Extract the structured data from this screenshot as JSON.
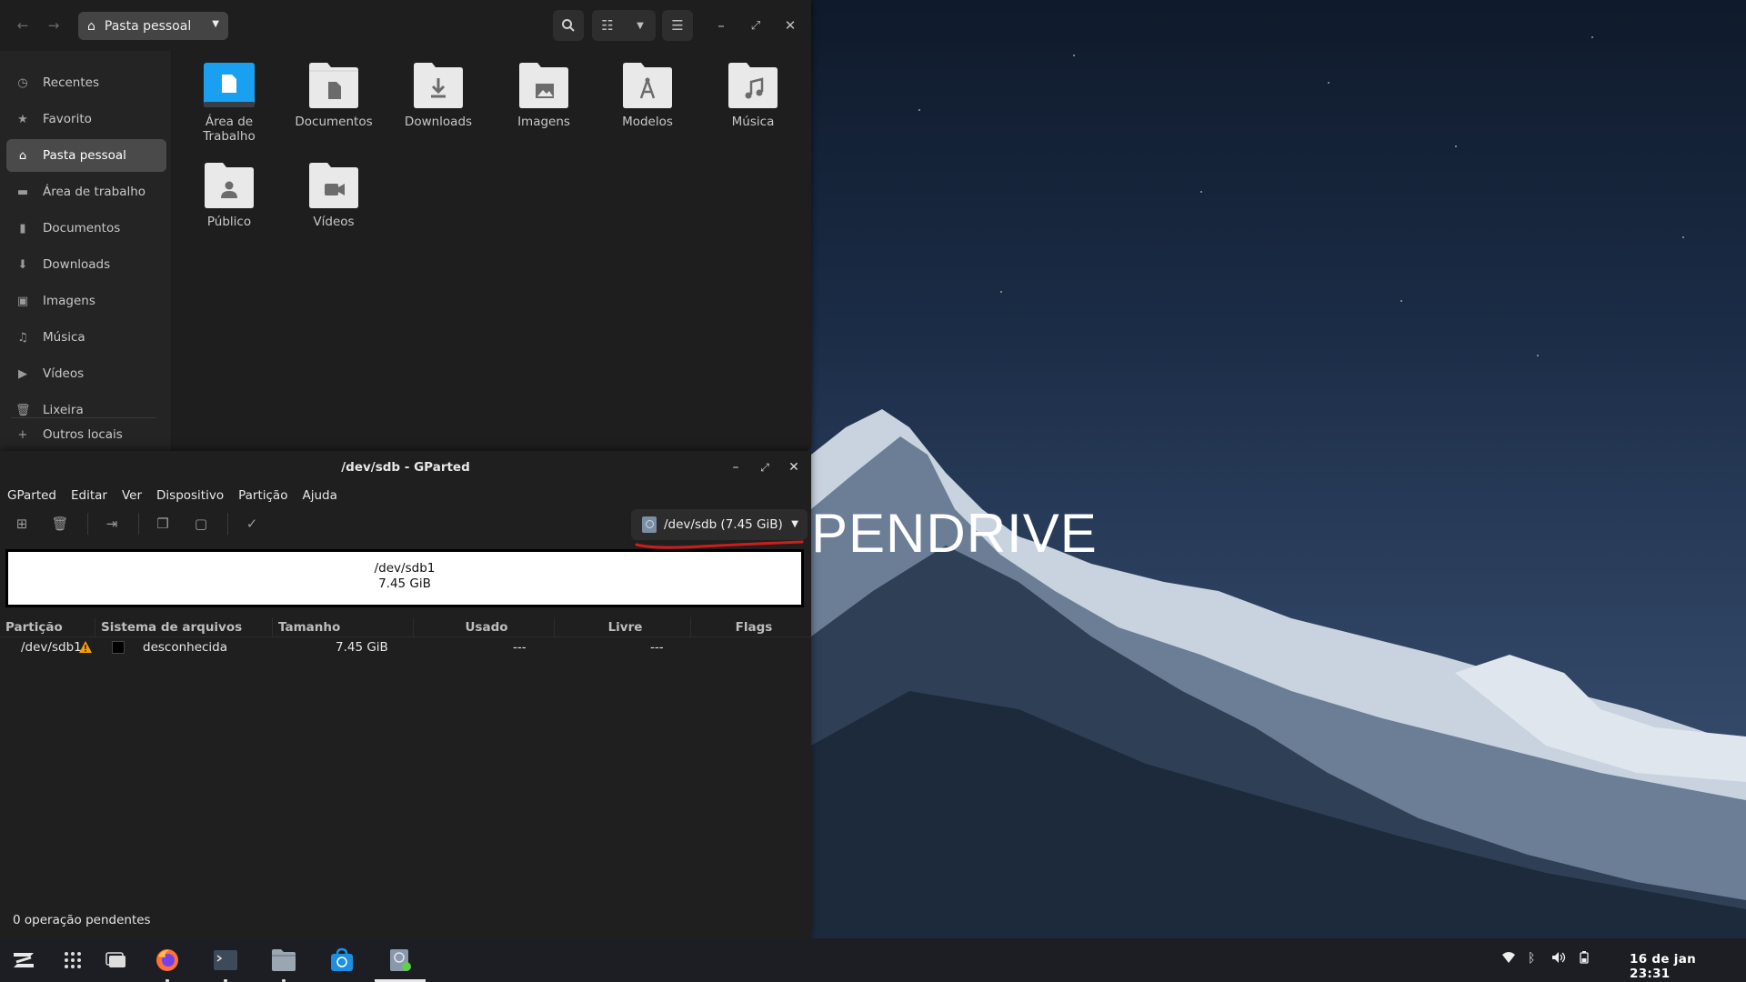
{
  "desktop": {
    "wallpaper_label": "PENDRIVE"
  },
  "files": {
    "path_button": "Pasta pessoal",
    "sidebar": [
      {
        "label": "Recentes",
        "icon": "clock-icon"
      },
      {
        "label": "Favorito",
        "icon": "star-icon"
      },
      {
        "label": "Pasta pessoal",
        "icon": "home-icon",
        "active": true
      },
      {
        "label": "Área de trabalho",
        "icon": "desktop-icon"
      },
      {
        "label": "Documentos",
        "icon": "document-icon"
      },
      {
        "label": "Downloads",
        "icon": "download-icon"
      },
      {
        "label": "Imagens",
        "icon": "image-icon"
      },
      {
        "label": "Música",
        "icon": "music-icon"
      },
      {
        "label": "Vídeos",
        "icon": "video-icon"
      },
      {
        "label": "Lixeira",
        "icon": "trash-icon"
      },
      {
        "label": "Outros locais",
        "icon": "plus-icon"
      }
    ],
    "folders": [
      {
        "label_line1": "Área de",
        "label_line2": "Trabalho",
        "emblem": "desktop"
      },
      {
        "label_line1": "Documentos",
        "label_line2": "",
        "emblem": "document"
      },
      {
        "label_line1": "Downloads",
        "label_line2": "",
        "emblem": "download"
      },
      {
        "label_line1": "Imagens",
        "label_line2": "",
        "emblem": "image"
      },
      {
        "label_line1": "Modelos",
        "label_line2": "",
        "emblem": "template"
      },
      {
        "label_line1": "Música",
        "label_line2": "",
        "emblem": "music"
      },
      {
        "label_line1": "Público",
        "label_line2": "",
        "emblem": "person"
      },
      {
        "label_line1": "Vídeos",
        "label_line2": "",
        "emblem": "video"
      }
    ]
  },
  "gparted": {
    "title": "/dev/sdb - GParted",
    "menu": [
      "GParted",
      "Editar",
      "Ver",
      "Dispositivo",
      "Partição",
      "Ajuda"
    ],
    "device_select": "/dev/sdb (7.45 GiB)",
    "graphic": {
      "name": "/dev/sdb1",
      "size": "7.45 GiB"
    },
    "columns": [
      "Partição",
      "Sistema de arquivos",
      "Tamanho",
      "Usado",
      "Livre",
      "Flags"
    ],
    "rows": [
      {
        "partition": "/dev/sdb1",
        "filesystem": "desconhecida",
        "size": "7.45 GiB",
        "used": "---",
        "free": "---",
        "flags": ""
      }
    ],
    "status": "0 operação pendentes"
  },
  "taskbar": {
    "date": "16 de jan",
    "time": "23:31"
  }
}
